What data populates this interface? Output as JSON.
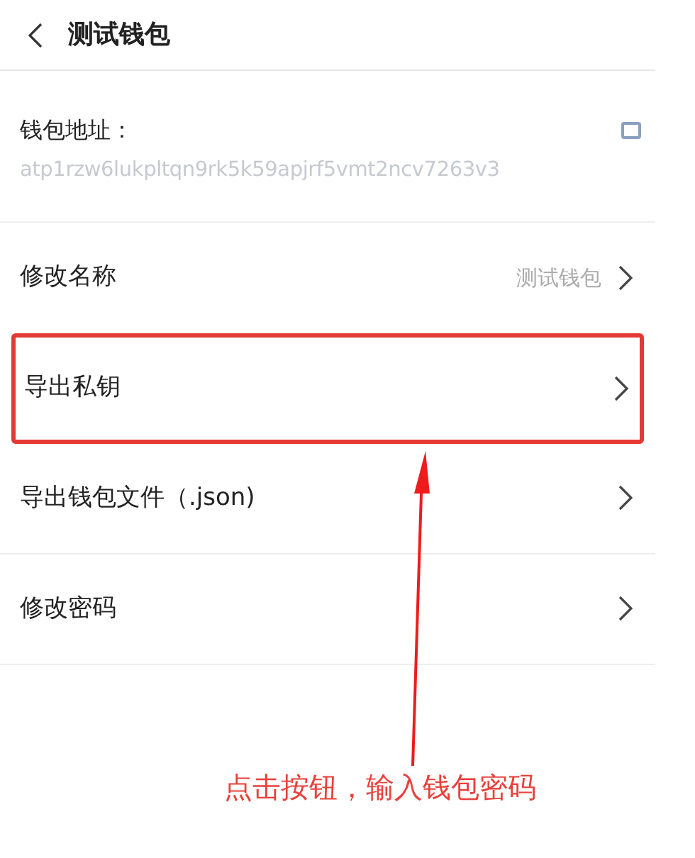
{
  "header": {
    "title": "测试钱包"
  },
  "address": {
    "label": "钱包地址：",
    "value": "atp1rzw6lukpltqn9rk5k59apjrf5vmt2ncv7263v3"
  },
  "rows": [
    {
      "label": "修改名称",
      "value": "测试钱包",
      "highlighted": false
    },
    {
      "label": "导出私钥",
      "highlighted": true
    },
    {
      "label": "导出钱包文件（.json)",
      "highlighted": false
    },
    {
      "label": "修改密码",
      "highlighted": false
    }
  ],
  "annotation": {
    "text": "点击按钮，输入钱包密码"
  }
}
